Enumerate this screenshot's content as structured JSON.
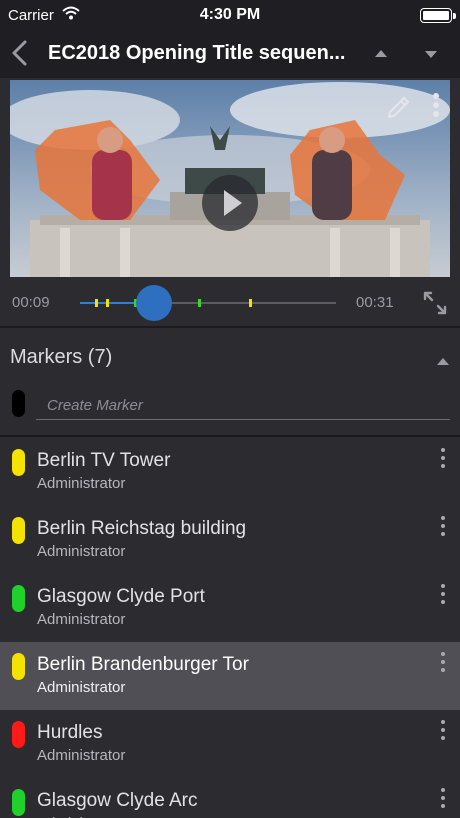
{
  "status_bar": {
    "carrier": "Carrier",
    "time": "4:30 PM"
  },
  "nav": {
    "title": "EC2018 Opening Title sequen...",
    "icons": [
      "back-chevron-icon",
      "previous-triangle-icon",
      "next-triangle-icon"
    ]
  },
  "video": {
    "icons": [
      "pencil-icon",
      "more-vertical-icon",
      "play-icon"
    ]
  },
  "player": {
    "current_time": "00:09",
    "end_time": "00:31",
    "progress": 0.29,
    "marker_ticks": [
      {
        "position": 0.06,
        "color": "#f4e200"
      },
      {
        "position": 0.1,
        "color": "#f4e200"
      },
      {
        "position": 0.21,
        "color": "#35d82a"
      },
      {
        "position": 0.46,
        "color": "#35d82a"
      },
      {
        "position": 0.66,
        "color": "#f4e200"
      }
    ]
  },
  "markers": {
    "header": "Markers (7)",
    "create_placeholder": "Create Marker",
    "items": [
      {
        "name": "Berlin TV Tower",
        "author": "Administrator",
        "color": "#f4e200",
        "selected": false
      },
      {
        "name": "Berlin Reichstag building",
        "author": "Administrator",
        "color": "#f4e200",
        "selected": false
      },
      {
        "name": "Glasgow Clyde Port",
        "author": "Administrator",
        "color": "#1fd12a",
        "selected": false
      },
      {
        "name": "Berlin Brandenburger Tor",
        "author": "Administrator",
        "color": "#f4e200",
        "selected": true
      },
      {
        "name": "Hurdles",
        "author": "Administrator",
        "color": "#ff1a1a",
        "selected": false
      },
      {
        "name": "Glasgow Clyde Arc",
        "author": "Administrator",
        "color": "#1fd12a",
        "selected": false
      }
    ]
  },
  "colors": {
    "accent": "#2f6fbf",
    "background": "#2b2b30",
    "selected_row": "#4f4f55"
  }
}
